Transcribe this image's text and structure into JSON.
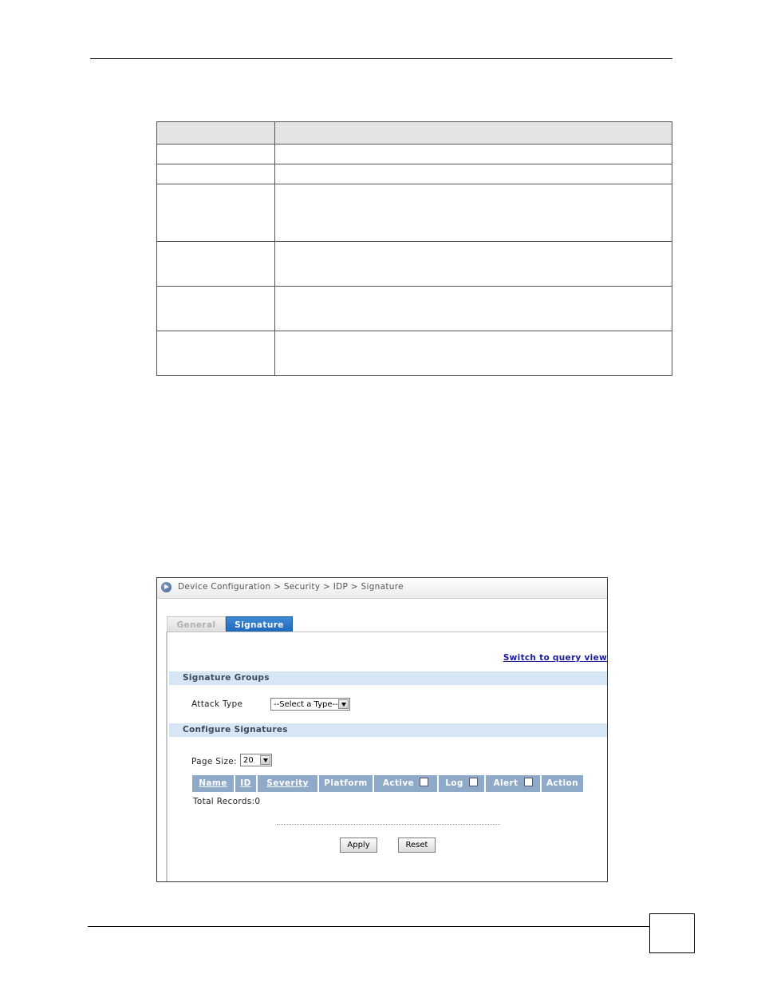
{
  "breadcrumb": "Device Configuration > Security > IDP > Signature",
  "tabs": [
    {
      "label": "General",
      "active": false
    },
    {
      "label": "Signature",
      "active": true
    }
  ],
  "switch_link": "Switch to query view",
  "groups": {
    "title": "Signature Groups",
    "attack_type_label": "Attack Type",
    "attack_type_value": "--Select a Type--"
  },
  "configure": {
    "title": "Configure Signatures",
    "page_size_label": "Page Size:",
    "page_size_value": "20",
    "columns": [
      "Name",
      "ID",
      "Severity",
      "Platform",
      "Active",
      "Log",
      "Alert",
      "Action"
    ],
    "total_records": "Total Records:0"
  },
  "buttons": {
    "apply": "Apply",
    "reset": "Reset"
  }
}
